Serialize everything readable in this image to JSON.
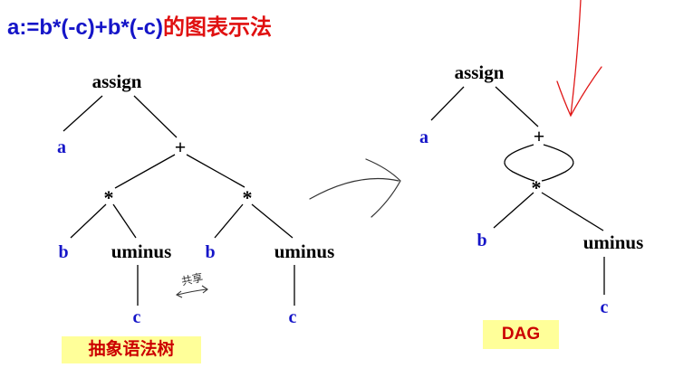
{
  "title": {
    "expr": "a:=b*(-c)+b*(-c)",
    "caption": "的图表示法"
  },
  "ast": {
    "label": "抽象语法树",
    "nodes": {
      "assign": "assign",
      "a": "a",
      "plus": "+",
      "star_left": "*",
      "star_right": "*",
      "b_left": "b",
      "uminus_left": "uminus",
      "b_right": "b",
      "uminus_right": "uminus",
      "c_left": "c",
      "c_right": "c"
    },
    "handwritten_note": "共享"
  },
  "dag": {
    "label": "DAG",
    "nodes": {
      "assign": "assign",
      "a": "a",
      "plus": "+",
      "star": "*",
      "b": "b",
      "uminus": "uminus",
      "c": "c"
    }
  },
  "colors": {
    "blue": "#1515c8",
    "red": "#e01010",
    "label_bg": "#ffff99"
  }
}
